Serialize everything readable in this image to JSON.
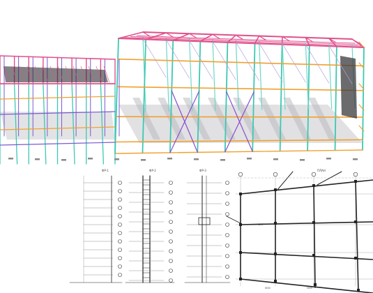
{
  "colors": {
    "roof_beam": "#e0508c",
    "column": "#3cc8b4",
    "girt": "#f0a030",
    "bracing": "#8a4ad0",
    "shadow": "#c8c8cc",
    "drawing_line": "#222222"
  },
  "sheet_labels": {
    "frame_a": "ФР-1",
    "frame_b": "ФР-2",
    "frame_c": "ФР-3",
    "plan": "ПЛАН"
  },
  "dimension_labels": {
    "d1": "6000",
    "d2": "9000",
    "d3": "12.0"
  }
}
